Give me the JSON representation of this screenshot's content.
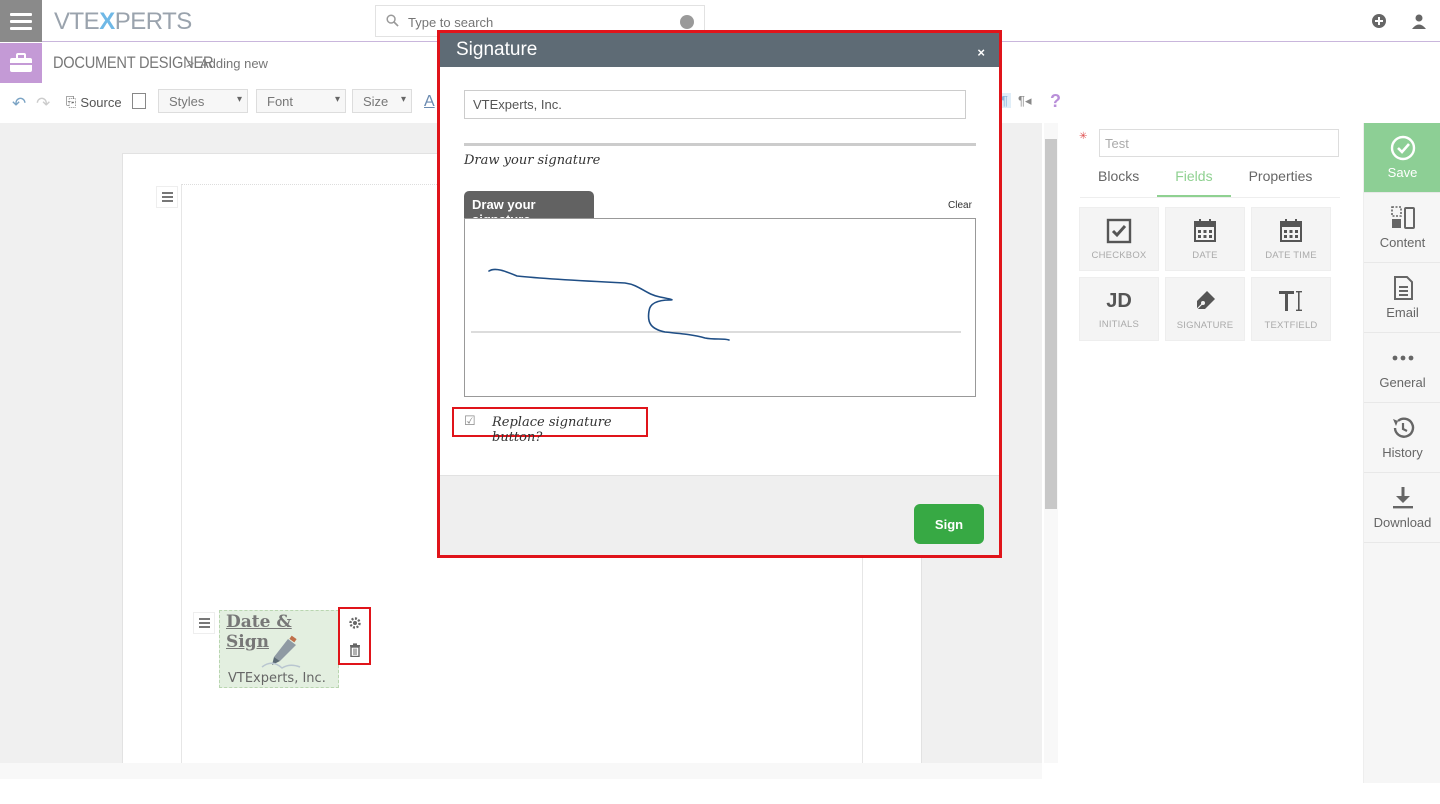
{
  "app": {
    "logo_left": "VTE",
    "logo_x": "X",
    "logo_right": "PERTS",
    "search_placeholder": "Type to search"
  },
  "header": {
    "module": "DOCUMENT DESIGNER",
    "separator": ">",
    "subpage": "Adding new"
  },
  "toolbar": {
    "source_label": "Source",
    "styles_label": "Styles",
    "font_label": "Font",
    "size_label": "Size",
    "help_label": "?",
    "pilcrow_label": "¶◂"
  },
  "canvas_widget": {
    "title": "Date & Sign",
    "company": "VTExperts, Inc."
  },
  "right_panel": {
    "name_value": "Test",
    "tabs": [
      "Blocks",
      "Fields",
      "Properties"
    ],
    "fields": [
      {
        "label": "CHECKBOX",
        "icon": "checkbox-icon"
      },
      {
        "label": "DATE",
        "icon": "calendar-icon"
      },
      {
        "label": "DATE TIME",
        "icon": "calendar-icon"
      },
      {
        "label": "INITIALS",
        "icon": "initials-icon",
        "glyph": "JD"
      },
      {
        "label": "SIGNATURE",
        "icon": "pen-icon"
      },
      {
        "label": "TEXTFIELD",
        "icon": "text-cursor-icon"
      }
    ]
  },
  "sidebar": {
    "items": [
      "Save",
      "Content",
      "Email",
      "General",
      "History",
      "Download"
    ]
  },
  "modal": {
    "title": "Signature",
    "close": "×",
    "name_value": "VTExperts, Inc.",
    "hint": "Draw your signature",
    "tab_label": "Draw your signature",
    "clear_label": "Clear",
    "checkbox_label": "Replace signature button?",
    "sign_label": "Sign"
  },
  "colors": {
    "accent_green": "#8dcf95",
    "sign_green": "#37a944",
    "highlight_red": "#e0141a",
    "modal_header": "#5e6b75",
    "module_purple": "#c49ad6"
  }
}
